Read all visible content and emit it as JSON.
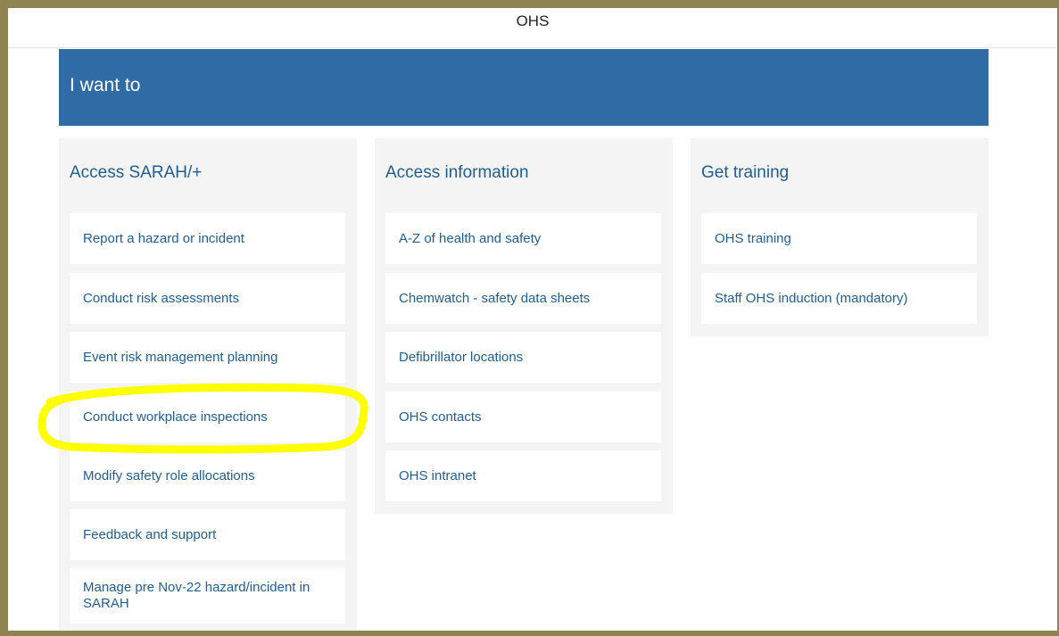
{
  "window": {
    "title": "OHS"
  },
  "banner": {
    "title": "I want to"
  },
  "columns": [
    {
      "heading": "Access SARAH/+",
      "items": [
        "Report a hazard or incident",
        "Conduct risk assessments",
        "Event risk management planning",
        "Conduct workplace inspections",
        "Modify safety role allocations",
        "Feedback and support",
        "Manage pre Nov-22 hazard/incident in SARAH"
      ]
    },
    {
      "heading": "Access information",
      "items": [
        "A-Z of health and safety",
        "Chemwatch - safety data sheets",
        "Defibrillator locations",
        "OHS contacts",
        "OHS intranet"
      ]
    },
    {
      "heading": "Get training",
      "items": [
        "OHS training",
        "Staff OHS induction (mandatory)"
      ]
    }
  ],
  "annotation": {
    "highlight_color": "#ffff00"
  },
  "colors": {
    "accent": "#2f6ca6",
    "link": "#1f5e93",
    "frame": "#8f8352"
  }
}
